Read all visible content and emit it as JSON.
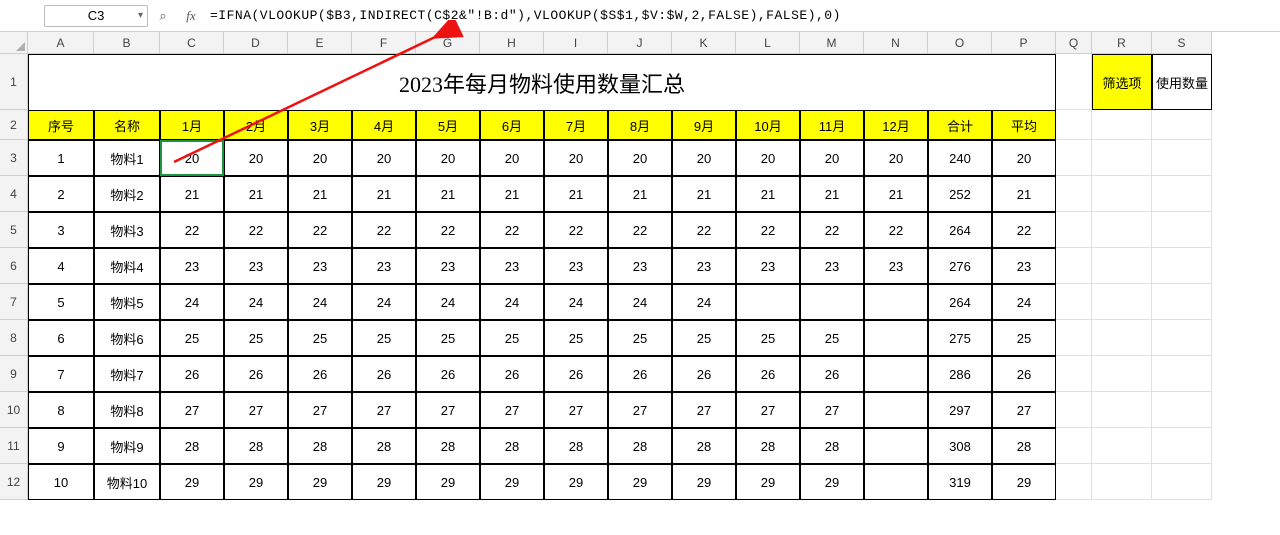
{
  "formula_bar": {
    "cell_ref": "C3",
    "formula": "=IFNA(VLOOKUP($B3,INDIRECT(C$2&\"!B:d\"),VLOOKUP($S$1,$V:$W,2,FALSE),FALSE),0)"
  },
  "columns": [
    "A",
    "B",
    "C",
    "D",
    "E",
    "F",
    "G",
    "H",
    "I",
    "J",
    "K",
    "L",
    "M",
    "N",
    "O",
    "P",
    "Q",
    "R",
    "S"
  ],
  "row_numbers": [
    "1",
    "2",
    "3",
    "4",
    "5",
    "6",
    "7",
    "8",
    "9",
    "10",
    "11",
    "12"
  ],
  "title": "2023年每月物料使用数量汇总",
  "filter_label": "筛选项",
  "usage_label": "使用数量",
  "headers": [
    "序号",
    "名称",
    "1月",
    "2月",
    "3月",
    "4月",
    "5月",
    "6月",
    "7月",
    "8月",
    "9月",
    "10月",
    "11月",
    "12月",
    "合计",
    "平均"
  ],
  "rows": [
    {
      "id": "1",
      "name": "物料1",
      "m": [
        "20",
        "20",
        "20",
        "20",
        "20",
        "20",
        "20",
        "20",
        "20",
        "20",
        "20",
        "20"
      ],
      "sum": "240",
      "avg": "20"
    },
    {
      "id": "2",
      "name": "物料2",
      "m": [
        "21",
        "21",
        "21",
        "21",
        "21",
        "21",
        "21",
        "21",
        "21",
        "21",
        "21",
        "21"
      ],
      "sum": "252",
      "avg": "21"
    },
    {
      "id": "3",
      "name": "物料3",
      "m": [
        "22",
        "22",
        "22",
        "22",
        "22",
        "22",
        "22",
        "22",
        "22",
        "22",
        "22",
        "22"
      ],
      "sum": "264",
      "avg": "22"
    },
    {
      "id": "4",
      "name": "物料4",
      "m": [
        "23",
        "23",
        "23",
        "23",
        "23",
        "23",
        "23",
        "23",
        "23",
        "23",
        "23",
        "23"
      ],
      "sum": "276",
      "avg": "23"
    },
    {
      "id": "5",
      "name": "物料5",
      "m": [
        "24",
        "24",
        "24",
        "24",
        "24",
        "24",
        "24",
        "24",
        "24",
        "",
        "",
        ""
      ],
      "sum": "264",
      "avg": "24"
    },
    {
      "id": "6",
      "name": "物料6",
      "m": [
        "25",
        "25",
        "25",
        "25",
        "25",
        "25",
        "25",
        "25",
        "25",
        "25",
        "25",
        ""
      ],
      "sum": "275",
      "avg": "25"
    },
    {
      "id": "7",
      "name": "物料7",
      "m": [
        "26",
        "26",
        "26",
        "26",
        "26",
        "26",
        "26",
        "26",
        "26",
        "26",
        "26",
        ""
      ],
      "sum": "286",
      "avg": "26"
    },
    {
      "id": "8",
      "name": "物料8",
      "m": [
        "27",
        "27",
        "27",
        "27",
        "27",
        "27",
        "27",
        "27",
        "27",
        "27",
        "27",
        ""
      ],
      "sum": "297",
      "avg": "27"
    },
    {
      "id": "9",
      "name": "物料9",
      "m": [
        "28",
        "28",
        "28",
        "28",
        "28",
        "28",
        "28",
        "28",
        "28",
        "28",
        "28",
        ""
      ],
      "sum": "308",
      "avg": "28"
    },
    {
      "id": "10",
      "name": "物料10",
      "m": [
        "29",
        "29",
        "29",
        "29",
        "29",
        "29",
        "29",
        "29",
        "29",
        "29",
        "29",
        ""
      ],
      "sum": "319",
      "avg": "29"
    }
  ],
  "icons": {
    "dropdown": "▾",
    "search": "⌕",
    "fx": "fx"
  }
}
